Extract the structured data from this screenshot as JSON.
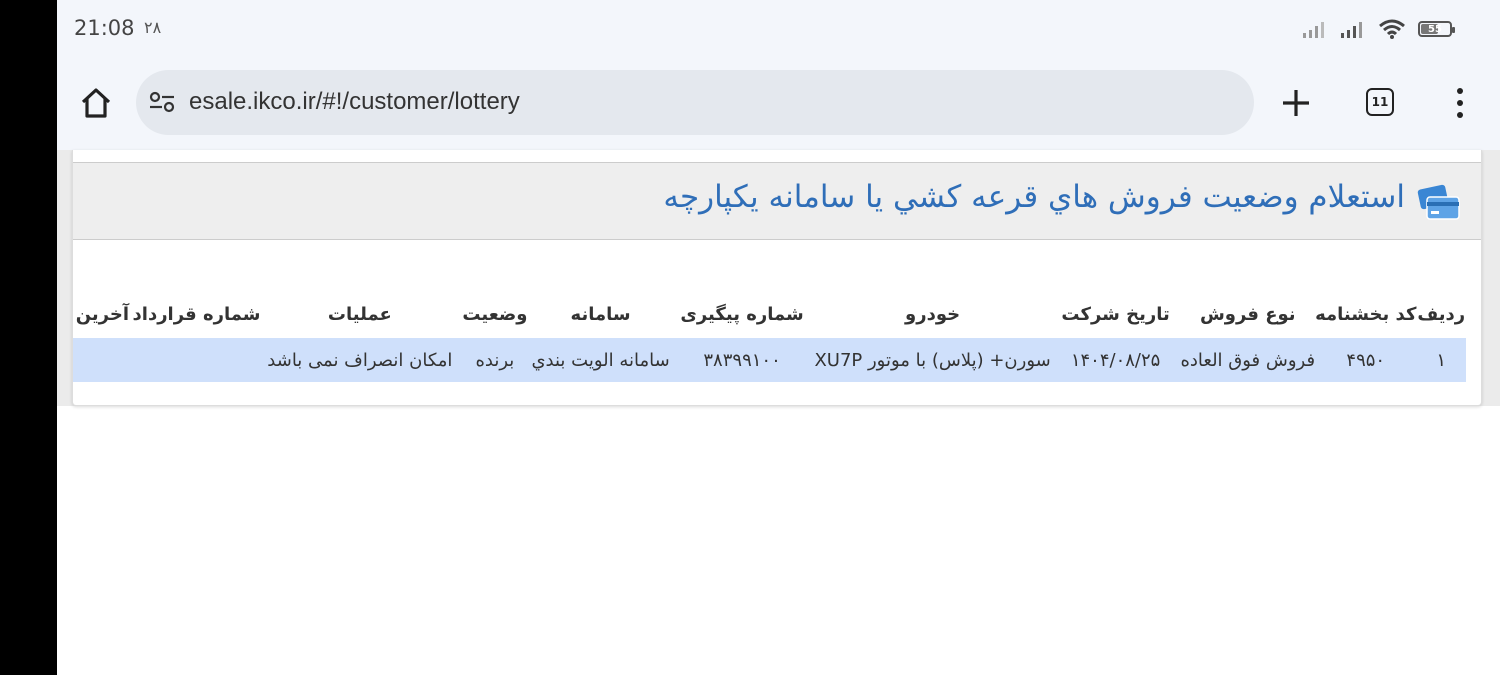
{
  "status_bar": {
    "time": "21:08",
    "date": "۲۸",
    "battery": "55"
  },
  "browser": {
    "url": "esale.ikco.ir/#!/customer/lottery",
    "tab_count": "11"
  },
  "panel": {
    "title": "استعلام وضعيت فروش هاي قرعه کشي يا سامانه يکپارچه"
  },
  "table": {
    "headers": [
      "رديف",
      "کد بخشنامه",
      "نوع فروش",
      "تاريخ شرکت",
      "خودرو",
      "شماره پیگیری",
      "سامانه",
      "وضعيت",
      "عمليات",
      "شماره قرارداد",
      "آخرين"
    ],
    "rows": [
      [
        "۱",
        "۴۹۵۰",
        "فروش فوق العاده",
        "۱۴۰۴/۰۸/۲۵",
        "سورن+ (پلاس) با موتور XU7P",
        "۳۸۳۹۹۱۰۰",
        "سامانه الويت بندي",
        "برنده",
        "امکان انصراف نمی باشد",
        "",
        ""
      ]
    ]
  },
  "colors": {
    "title": "#2f6eb8",
    "row_highlight": "#cfe0fb",
    "header_band": "#eeeeee"
  }
}
